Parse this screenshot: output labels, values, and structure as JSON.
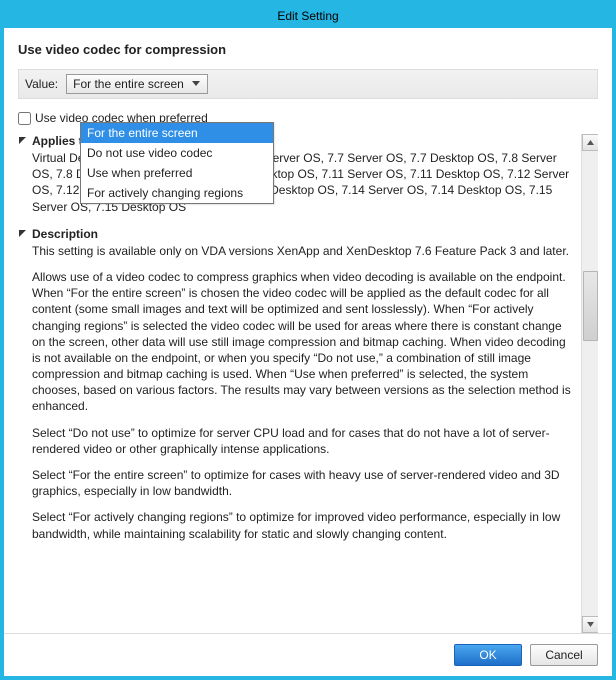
{
  "window": {
    "title": "Edit Setting"
  },
  "setting": {
    "title": "Use video codec for compression"
  },
  "value": {
    "label": "Value:",
    "selected": "For the entire screen"
  },
  "dropdown": {
    "options": [
      "For the entire screen",
      "Do not use video codec",
      "Use when preferred",
      "For actively changing regions"
    ]
  },
  "checkbox": {
    "label": "Use video codec when preferred"
  },
  "sections": {
    "applies": {
      "header": "Applies to the following VDA versions",
      "body": "Virtual Delivery Agent: 7.6 Desktop OS, 7.6 Server OS, 7.7 Server OS, 7.7 Desktop OS, 7.8 Server OS, 7.8 Desktop OS, 7.9 Server OS, 7.9 Desktop OS, 7.11 Server OS, 7.11 Desktop OS, 7.12 Server OS, 7.12 Desktop OS, 7.13 Server OS, 7.13 Desktop OS, 7.14 Server OS, 7.14 Desktop OS, 7.15 Server OS, 7.15 Desktop OS"
    },
    "description": {
      "header": "Description",
      "p1": "This setting is available only on VDA versions XenApp and XenDesktop 7.6 Feature Pack 3 and later.",
      "p2": "Allows use of a video codec to compress graphics when video decoding is available on the endpoint. When “For the entire screen” is chosen the video codec will be applied as the default codec for all content (some small images and text will be optimized and sent losslessly). When “For actively changing regions” is selected the video codec will be used for areas where there is constant change on the screen, other data will use still image compression and bitmap caching. When video decoding is not available on the endpoint, or when you specify “Do not use,” a combination of still image compression and bitmap caching is used. When “Use when preferred” is selected, the system chooses, based on various factors. The results may vary between versions as the selection method is enhanced.",
      "p3": "Select “Do not use” to optimize for server CPU load and for cases that do not have a lot of server-rendered video or other graphically intense applications.",
      "p4": "Select “For the entire screen” to optimize for cases with heavy use of server-rendered video and 3D graphics, especially in low bandwidth.",
      "p5": "Select “For actively changing regions” to optimize for improved video performance, especially in low bandwidth, while maintaining scalability for static and slowly changing content."
    }
  },
  "buttons": {
    "ok": "OK",
    "cancel": "Cancel"
  }
}
